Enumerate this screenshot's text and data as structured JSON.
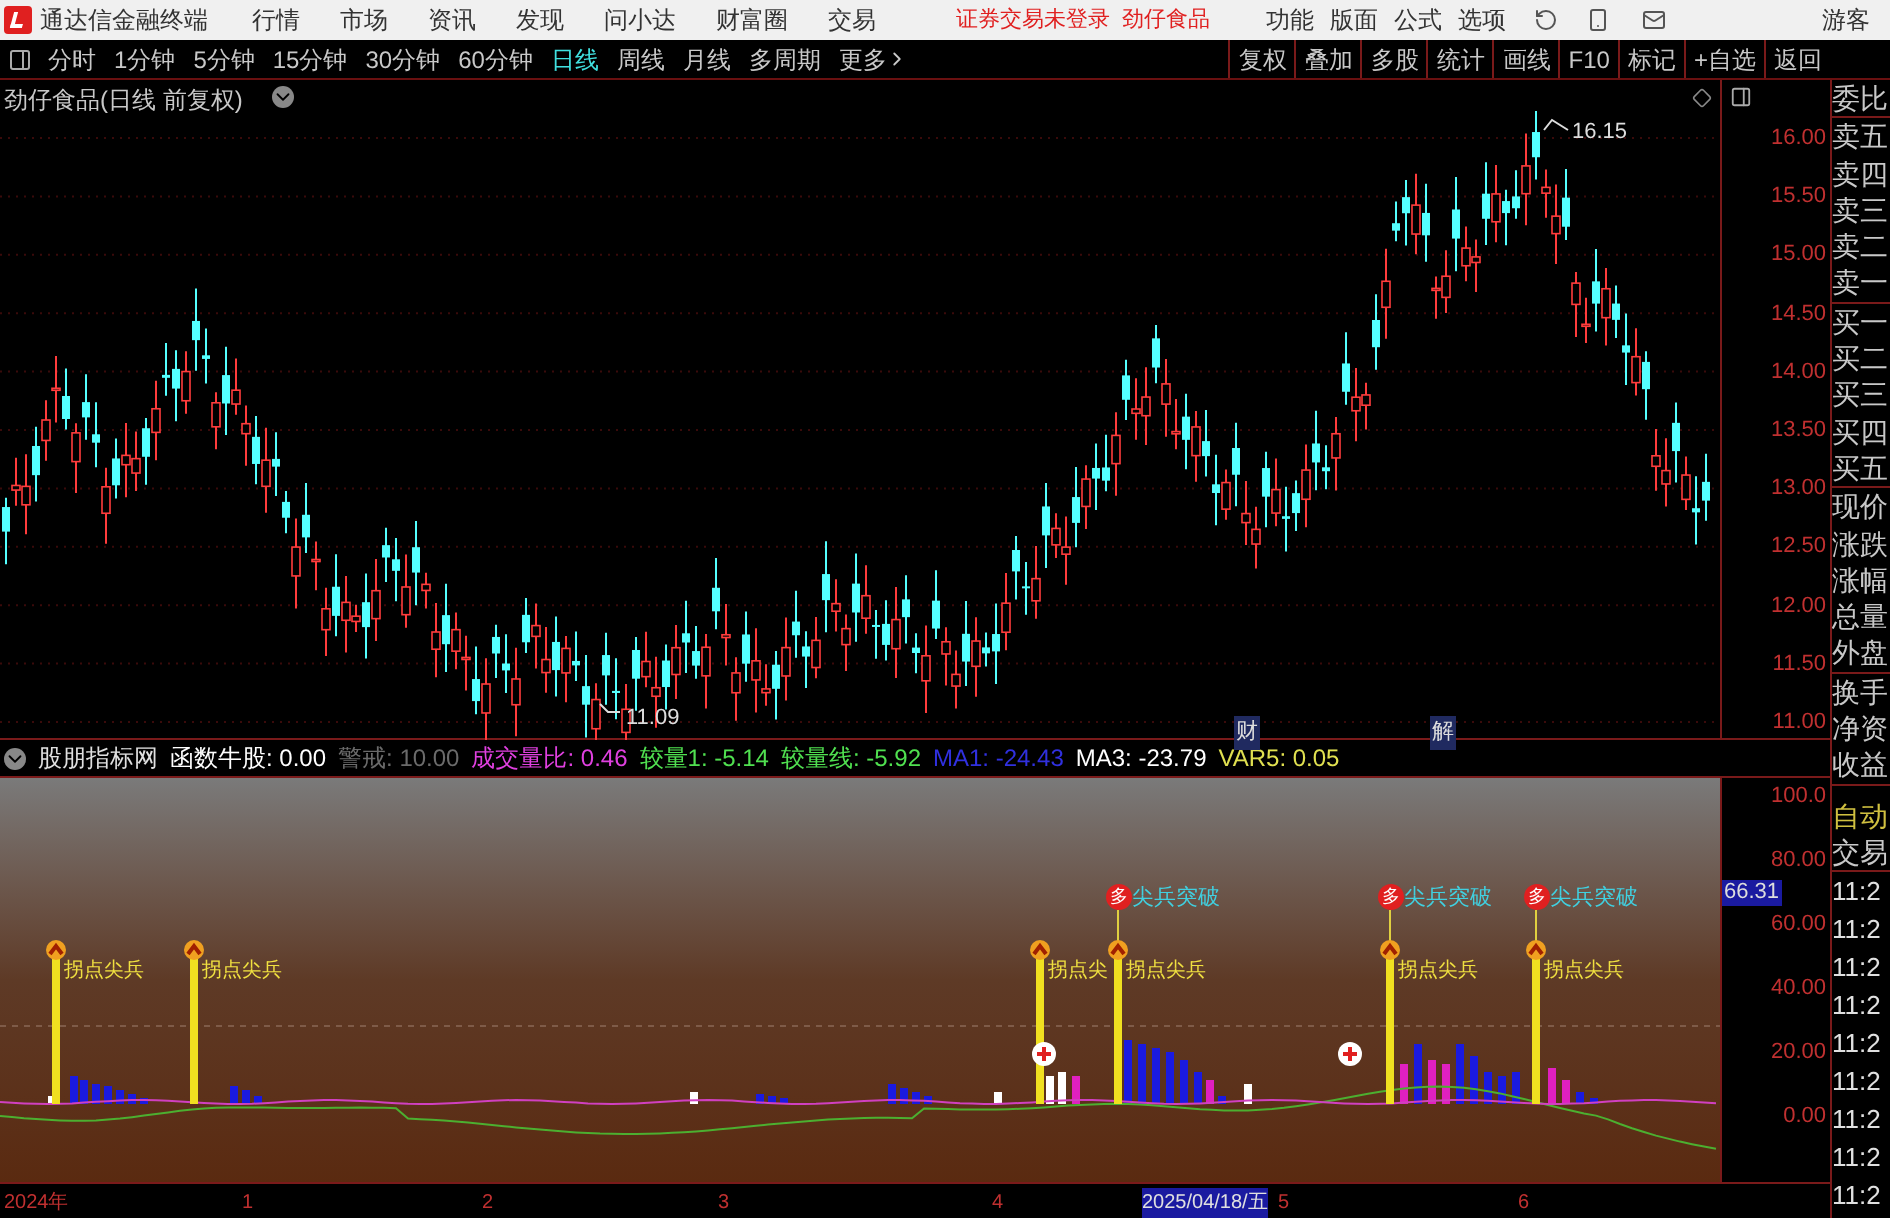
{
  "app_bar": {
    "title": "通达信金融终端",
    "menus": [
      "行情",
      "市场",
      "资讯",
      "发现",
      "问小达",
      "财富圈",
      "交易"
    ],
    "notice": "证券交易未登录",
    "stock": "劲仔食品",
    "right_menus": [
      "功能",
      "版面",
      "公式",
      "选项"
    ],
    "user": "游客"
  },
  "periods": [
    {
      "label": "分时",
      "selected": false
    },
    {
      "label": "1分钟",
      "selected": false
    },
    {
      "label": "5分钟",
      "selected": false
    },
    {
      "label": "15分钟",
      "selected": false
    },
    {
      "label": "30分钟",
      "selected": false
    },
    {
      "label": "60分钟",
      "selected": false
    },
    {
      "label": "日线",
      "selected": true
    },
    {
      "label": "周线",
      "selected": false
    },
    {
      "label": "月线",
      "selected": false
    },
    {
      "label": "多周期",
      "selected": false
    }
  ],
  "more": "更多",
  "tools": [
    "复权",
    "叠加",
    "多股",
    "统计",
    "画线",
    "F10",
    "标记",
    "+自选",
    "返回"
  ],
  "price_chart": {
    "title": "劲仔食品(日线 前复权)",
    "high_label": "16.15",
    "low_label": "11.09",
    "events": [
      "财",
      "解"
    ],
    "y_ticks": [
      "16.00",
      "15.50",
      "15.00",
      "14.50",
      "14.00",
      "13.50",
      "13.00",
      "12.50",
      "12.00",
      "11.50",
      "11.00"
    ]
  },
  "indicator": {
    "name": "股朋指标网",
    "values": [
      "函数牛股: 0.00",
      "警戒: 10.00",
      "成交量比: 0.46",
      "较量1: -5.14",
      "较量线: -5.92",
      "MA1: -24.43",
      "MA3: -23.79",
      "VAR5: 0.05"
    ],
    "y_ticks": [
      "100.0",
      "80.00",
      "60.00",
      "40.00",
      "20.00",
      "0.00"
    ],
    "current": "66.31",
    "turn_signals": [
      "拐点尖兵",
      "拐点尖兵",
      "拐点尖",
      "拐点尖兵",
      "拐点尖兵",
      "拐点尖兵"
    ],
    "breakout_signals": [
      {
        "badge": "多",
        "label": "尖兵突破"
      },
      {
        "badge": "多",
        "label": "尖兵突破"
      },
      {
        "badge": "多",
        "label": "尖兵突破"
      }
    ]
  },
  "x_axis": [
    {
      "label": "2024年",
      "selected": false
    },
    {
      "label": "1",
      "selected": false
    },
    {
      "label": "2",
      "selected": false
    },
    {
      "label": "3",
      "selected": false
    },
    {
      "label": "4",
      "selected": false
    },
    {
      "label": "2025/04/18/五",
      "selected": true
    },
    {
      "label": "5",
      "selected": false
    },
    {
      "label": "6",
      "selected": false
    }
  ],
  "side_panel": {
    "groups": [
      [
        "委比"
      ],
      [
        "卖五",
        "卖四",
        "卖三",
        "卖二",
        "卖一"
      ],
      [
        "买一",
        "买二",
        "买三",
        "买四",
        "买五"
      ],
      [
        "现价",
        "涨跌",
        "涨幅",
        "总量",
        "外盘"
      ],
      [
        "换手",
        "净资",
        "收益"
      ]
    ],
    "auto": "自动",
    "trade": "交易",
    "times": [
      "11:2",
      "11:2",
      "11:2",
      "11:2",
      "11:2",
      "11:2",
      "11:2",
      "11:2",
      "11:2"
    ]
  }
}
